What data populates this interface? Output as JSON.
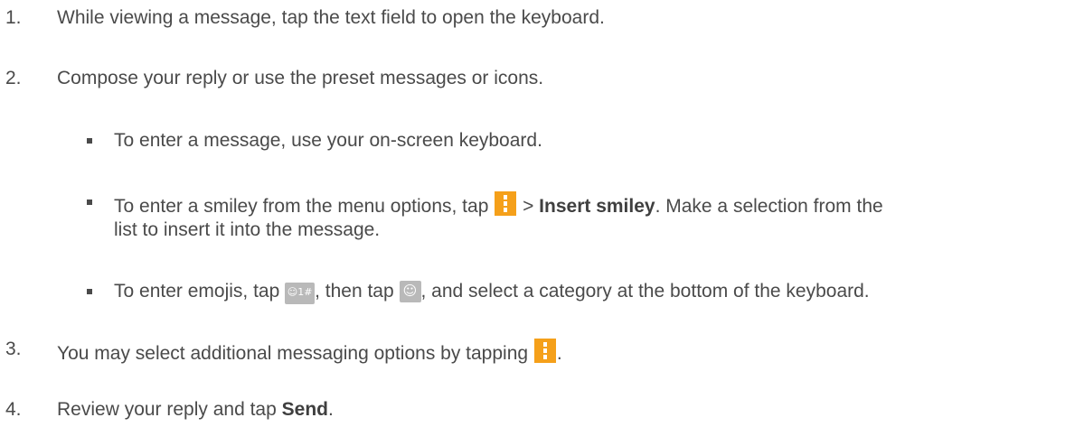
{
  "steps": [
    {
      "num": "1.",
      "text": "While viewing a message, tap the text field to open the keyboard."
    },
    {
      "num": "2.",
      "text": "Compose your reply or use the preset messages or icons."
    },
    {
      "num": "3.",
      "text_before": "You may select additional messaging options by tapping",
      "text_after": "."
    },
    {
      "num": "4.",
      "text_before": "Review your reply and tap ",
      "bold": "Send",
      "text_after": "."
    }
  ],
  "bullets": {
    "b1": {
      "text": "To enter a message, use your on-screen keyboard."
    },
    "b2": {
      "text_before": "To enter a smiley from the menu options, tap",
      "sep": " > ",
      "bold": "Insert smiley",
      "text_after": ". Make a selection from the",
      "line2": "list to insert it into the message."
    },
    "b3": {
      "text_before": "To enter emojis, tap ",
      "text_mid": ", then tap ",
      "text_after": ", and select a category at the bottom of the keyboard."
    }
  },
  "icons": {
    "menu": {
      "name": "menu-icon",
      "color": "#f5a01a"
    },
    "symbols_key": {
      "name": "symbols-key-icon",
      "label": "☺1#"
    },
    "emoji_key": {
      "name": "emoji-key-icon",
      "label": "☺"
    }
  }
}
